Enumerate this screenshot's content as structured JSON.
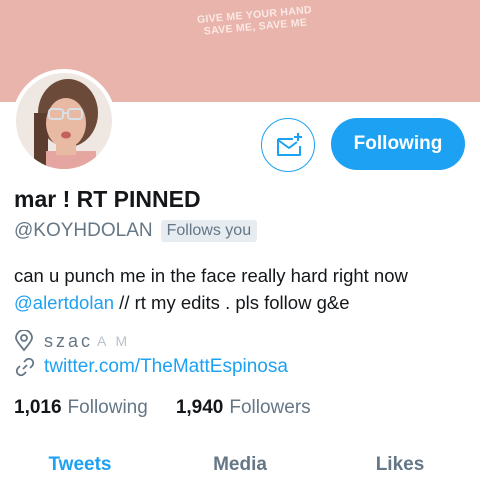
{
  "banner": {
    "line1": "GIVE ME YOUR HAND",
    "line2": "SAVE ME, SAVE ME"
  },
  "actions": {
    "follow_label": "Following"
  },
  "profile": {
    "name": "mar ! RT PINNED",
    "handle": "@KOYHDOLAN",
    "follows_you": "Follows you",
    "bio_line1": "can u punch me in the face really hard right now",
    "bio_mention": "@alertdolan",
    "bio_rest": " // rt my edits . pls follow g&e",
    "location": "szac",
    "location_faint": "A M",
    "url": "twitter.com/TheMattEspinosa"
  },
  "stats": {
    "following_count": "1,016",
    "following_label": "Following",
    "followers_count": "1,940",
    "followers_label": "Followers"
  },
  "tabs": [
    {
      "label": "Tweets",
      "active": true
    },
    {
      "label": "Media",
      "active": false
    },
    {
      "label": "Likes",
      "active": false
    }
  ],
  "colors": {
    "accent": "#1da1f2",
    "banner": "#e9b4ab",
    "secondary_text": "#657786"
  }
}
